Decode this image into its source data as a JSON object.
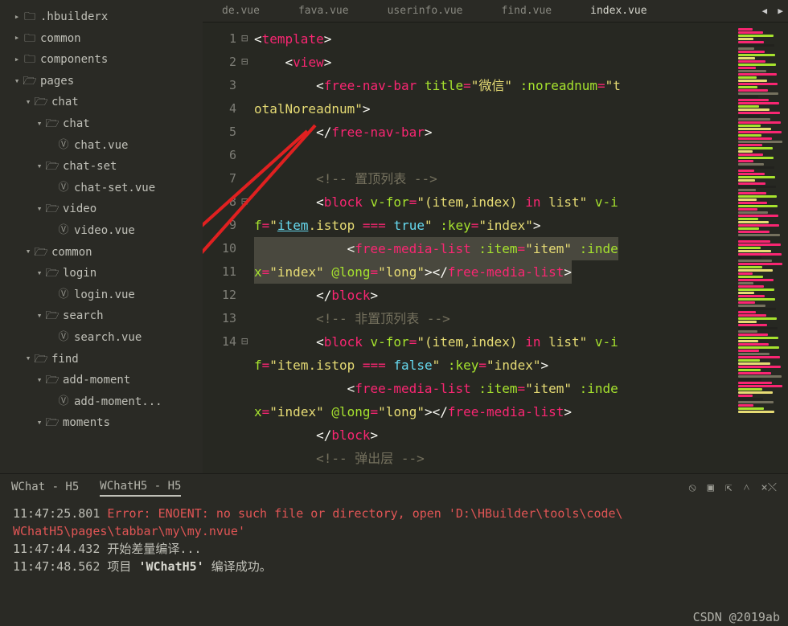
{
  "tabs": [
    "de.vue",
    "fava.vue",
    "userinfo.vue",
    "find.vue",
    "index.vue"
  ],
  "tree": [
    {
      "depth": 0,
      "caret": "▸",
      "kind": "folder",
      "label": ".hbuilderx"
    },
    {
      "depth": 0,
      "caret": "▸",
      "kind": "folder",
      "label": "common"
    },
    {
      "depth": 0,
      "caret": "▸",
      "kind": "folder",
      "label": "components"
    },
    {
      "depth": 0,
      "caret": "▾",
      "kind": "folder-open",
      "label": "pages"
    },
    {
      "depth": 1,
      "caret": "▾",
      "kind": "folder-open",
      "label": "chat"
    },
    {
      "depth": 2,
      "caret": "▾",
      "kind": "folder-open",
      "label": "chat"
    },
    {
      "depth": 3,
      "caret": "",
      "kind": "file",
      "label": "chat.vue"
    },
    {
      "depth": 2,
      "caret": "▾",
      "kind": "folder-open",
      "label": "chat-set"
    },
    {
      "depth": 3,
      "caret": "",
      "kind": "file",
      "label": "chat-set.vue"
    },
    {
      "depth": 2,
      "caret": "▾",
      "kind": "folder-open",
      "label": "video"
    },
    {
      "depth": 3,
      "caret": "",
      "kind": "file",
      "label": "video.vue"
    },
    {
      "depth": 1,
      "caret": "▾",
      "kind": "folder-open",
      "label": "common"
    },
    {
      "depth": 2,
      "caret": "▾",
      "kind": "folder-open",
      "label": "login"
    },
    {
      "depth": 3,
      "caret": "",
      "kind": "file",
      "label": "login.vue"
    },
    {
      "depth": 2,
      "caret": "▾",
      "kind": "folder-open",
      "label": "search"
    },
    {
      "depth": 3,
      "caret": "",
      "kind": "file",
      "label": "search.vue"
    },
    {
      "depth": 1,
      "caret": "▾",
      "kind": "folder-open",
      "label": "find"
    },
    {
      "depth": 2,
      "caret": "▾",
      "kind": "folder-open",
      "label": "add-moment"
    },
    {
      "depth": 3,
      "caret": "",
      "kind": "file",
      "label": "add-moment..."
    },
    {
      "depth": 2,
      "caret": "▾",
      "kind": "folder-open",
      "label": "moments"
    }
  ],
  "editor": {
    "lines": [
      {
        "n": 1,
        "fold": "⊟",
        "tokens": [
          [
            "pn",
            "<"
          ],
          [
            "tg",
            "template"
          ],
          [
            "pn",
            ">"
          ]
        ]
      },
      {
        "n": 2,
        "fold": "⊟",
        "tokens": [
          [
            "pn",
            "    <"
          ],
          [
            "tg",
            "view"
          ],
          [
            "pn",
            ">"
          ]
        ]
      },
      {
        "n": 3,
        "fold": "",
        "tokens": [
          [
            "pn",
            "        <"
          ],
          [
            "tg",
            "free-nav-bar"
          ],
          [
            "pn",
            " "
          ],
          [
            "at",
            "title"
          ],
          [
            "op",
            "="
          ],
          [
            "st",
            "\"微信\""
          ],
          [
            "pn",
            " "
          ],
          [
            "at",
            ":noreadnum"
          ],
          [
            "op",
            "="
          ],
          [
            "st",
            "\"t"
          ]
        ]
      },
      {
        "wrap": true,
        "tokens": [
          [
            "st",
            "otalNoreadnum\""
          ],
          [
            "pn",
            ">"
          ]
        ]
      },
      {
        "n": 4,
        "fold": "",
        "tokens": [
          [
            "pn",
            "        </"
          ],
          [
            "tg",
            "free-nav-bar"
          ],
          [
            "pn",
            ">"
          ]
        ]
      },
      {
        "n": 5,
        "fold": "",
        "tokens": [
          [
            "pn",
            ""
          ]
        ]
      },
      {
        "n": 6,
        "fold": "",
        "tokens": [
          [
            "cm",
            "        <!-- 置顶列表 -->"
          ]
        ]
      },
      {
        "n": 7,
        "fold": "⊟",
        "tokens": [
          [
            "pn",
            "        <"
          ],
          [
            "tg",
            "block"
          ],
          [
            "pn",
            " "
          ],
          [
            "at",
            "v-for"
          ],
          [
            "op",
            "="
          ],
          [
            "st",
            "\"(item,index) "
          ],
          [
            "kw",
            "in"
          ],
          [
            "st",
            " list\""
          ],
          [
            "pn",
            " "
          ],
          [
            "at",
            "v-i"
          ]
        ]
      },
      {
        "wrap": true,
        "tokens": [
          [
            "at",
            "f"
          ],
          [
            "op",
            "="
          ],
          [
            "st",
            "\""
          ],
          [
            "bl",
            "item"
          ],
          [
            "st",
            ".istop "
          ],
          [
            "op",
            "==="
          ],
          [
            "st",
            " "
          ],
          [
            "bl",
            "true"
          ],
          [
            "st",
            "\""
          ],
          [
            "pn",
            " "
          ],
          [
            "at",
            ":key"
          ],
          [
            "op",
            "="
          ],
          [
            "st",
            "\"index\""
          ],
          [
            "pn",
            ">"
          ]
        ],
        "itemUnderline": true
      },
      {
        "n": 8,
        "fold": "",
        "sel": true,
        "tokens": [
          [
            "pn",
            "            <"
          ],
          [
            "tg",
            "free-media-list"
          ],
          [
            "pn",
            " "
          ],
          [
            "at",
            ":item"
          ],
          [
            "op",
            "="
          ],
          [
            "st",
            "\"item\""
          ],
          [
            "pn",
            " "
          ],
          [
            "at",
            ":inde"
          ]
        ]
      },
      {
        "wrap": true,
        "sel": true,
        "tokens": [
          [
            "at",
            "x"
          ],
          [
            "op",
            "="
          ],
          [
            "st",
            "\"index\""
          ],
          [
            "pn",
            " "
          ],
          [
            "at",
            "@long"
          ],
          [
            "op",
            "="
          ],
          [
            "st",
            "\"long\""
          ],
          [
            "pn",
            "></"
          ],
          [
            "tg",
            "free-media-list"
          ],
          [
            "pn",
            ">"
          ]
        ]
      },
      {
        "n": 9,
        "fold": "",
        "tokens": [
          [
            "pn",
            "        </"
          ],
          [
            "tg",
            "block"
          ],
          [
            "pn",
            ">"
          ]
        ]
      },
      {
        "n": 10,
        "fold": "",
        "tokens": [
          [
            "cm",
            "        <!-- 非置顶列表 -->"
          ]
        ]
      },
      {
        "n": 11,
        "fold": "⊟",
        "tokens": [
          [
            "pn",
            "        <"
          ],
          [
            "tg",
            "block"
          ],
          [
            "pn",
            " "
          ],
          [
            "at",
            "v-for"
          ],
          [
            "op",
            "="
          ],
          [
            "st",
            "\"(item,index) "
          ],
          [
            "kw",
            "in"
          ],
          [
            "st",
            " list\""
          ],
          [
            "pn",
            " "
          ],
          [
            "at",
            "v-i"
          ]
        ]
      },
      {
        "wrap": true,
        "tokens": [
          [
            "at",
            "f"
          ],
          [
            "op",
            "="
          ],
          [
            "st",
            "\"item.istop "
          ],
          [
            "op",
            "==="
          ],
          [
            "st",
            " "
          ],
          [
            "bl",
            "false"
          ],
          [
            "st",
            "\""
          ],
          [
            "pn",
            " "
          ],
          [
            "at",
            ":key"
          ],
          [
            "op",
            "="
          ],
          [
            "st",
            "\"index\""
          ],
          [
            "pn",
            ">"
          ]
        ]
      },
      {
        "n": 12,
        "fold": "",
        "tokens": [
          [
            "pn",
            "            <"
          ],
          [
            "tg",
            "free-media-list"
          ],
          [
            "pn",
            " "
          ],
          [
            "at",
            ":item"
          ],
          [
            "op",
            "="
          ],
          [
            "st",
            "\"item\""
          ],
          [
            "pn",
            " "
          ],
          [
            "at",
            ":inde"
          ]
        ]
      },
      {
        "wrap": true,
        "tokens": [
          [
            "at",
            "x"
          ],
          [
            "op",
            "="
          ],
          [
            "st",
            "\"index\""
          ],
          [
            "pn",
            " "
          ],
          [
            "at",
            "@long"
          ],
          [
            "op",
            "="
          ],
          [
            "st",
            "\"long\""
          ],
          [
            "pn",
            "></"
          ],
          [
            "tg",
            "free-media-list"
          ],
          [
            "pn",
            ">"
          ]
        ]
      },
      {
        "n": 13,
        "fold": "",
        "tokens": [
          [
            "pn",
            "        </"
          ],
          [
            "tg",
            "block"
          ],
          [
            "pn",
            ">"
          ]
        ]
      },
      {
        "n": 14,
        "fold": "",
        "tokens": [
          [
            "cm",
            "        <!-- 弹出层 -->"
          ]
        ]
      }
    ]
  },
  "minimap_colors": [
    "#f92672",
    "#f92672",
    "#a6e22e",
    "#e6db74",
    "#f92672",
    "#22221e",
    "#75715e",
    "#f92672",
    "#a6e22e",
    "#e6db74",
    "#f92672",
    "#a6e22e",
    "#f92672",
    "#75715e",
    "#f92672",
    "#a6e22e",
    "#e6db74",
    "#f92672",
    "#a6e22e",
    "#f92672",
    "#75715e",
    "#22221e"
  ],
  "console": {
    "tabs": [
      "WChat - H5",
      "WChatH5 - H5"
    ],
    "lines": [
      {
        "ts": "11:47:25.801",
        "msg": "Error: ENOENT: no such file or directory, open 'D:\\HBuilder\\tools\\code\\"
      },
      {
        "msg": "WChatH5\\pages\\tabbar\\my\\my.nvue'"
      },
      {
        "ts": "11:47:44.432",
        "msg": "开始差量编译..."
      },
      {
        "ts": "11:47:48.562",
        "pre": "项目 ",
        "bold": "'WChatH5'",
        "post": " 编译成功。"
      }
    ]
  },
  "watermark": "CSDN @2019ab"
}
